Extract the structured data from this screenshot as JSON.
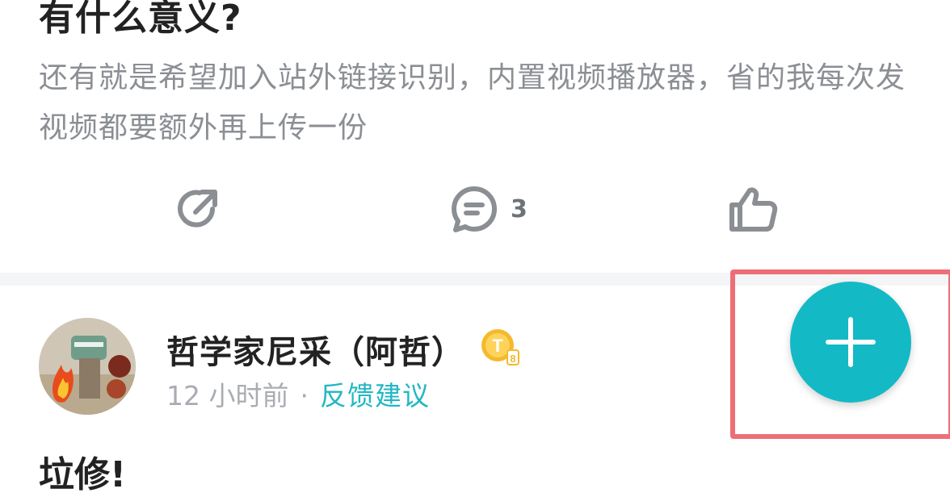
{
  "post": {
    "title": "有什么意义?",
    "body": "还有就是希望加入站外链接识别，内置视频播放器，省的我每次发视频都要额外再上传一份",
    "actions": {
      "share_icon": "share-arrow-icon",
      "comment_icon": "comment-bubble-icon",
      "comment_count": "3",
      "like_icon": "thumbs-up-icon"
    }
  },
  "next_post": {
    "author_name": "哲学家尼采（阿哲）",
    "badge_letter": "T",
    "badge_level": "8",
    "time": "12 小时前",
    "separator": "·",
    "category": "反馈建议",
    "title_partial": "垃修!"
  },
  "fab": {
    "icon": "plus-icon",
    "color": "#14b9c6"
  },
  "highlight_color": "#ee6e77"
}
